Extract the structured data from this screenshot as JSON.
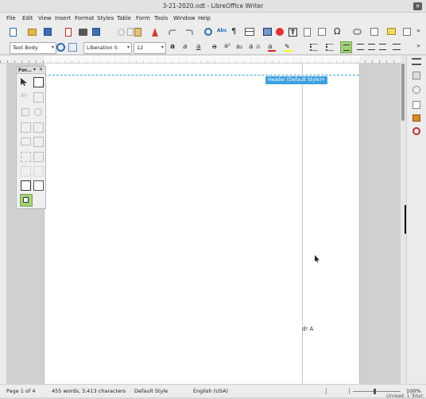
{
  "window": {
    "title": "3-21-2020.odt - LibreOffice Writer",
    "close_glyph": "✕"
  },
  "menu": [
    "File",
    "Edit",
    "View",
    "Insert",
    "Format",
    "Styles",
    "Table",
    "Form",
    "Tools",
    "Window",
    "Help"
  ],
  "formatting": {
    "paragraph_style": "Text Body",
    "font_name": "Liberation S",
    "font_size": "12"
  },
  "header_tag": {
    "label": "Header (Default Style)",
    "plus": "+"
  },
  "form_palette": {
    "title": "For...",
    "close_glyph": "✕",
    "dropdown_glyph": "▾"
  },
  "document": {
    "visible_text": "d! A"
  },
  "status": {
    "page": "Page 1 of 4",
    "words": "455 words, 3,413 characters",
    "page_style": "Default Style",
    "language": "English (USA)",
    "zoom": "100%",
    "overflow_text": "Unread: 1   Total:"
  },
  "colors": {
    "accent": "#3c9fe0",
    "selected_bg": "#a4d07a"
  }
}
